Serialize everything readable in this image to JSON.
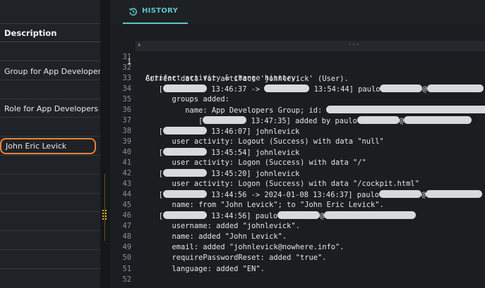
{
  "left": {
    "column_header": "Description",
    "rows": [
      {
        "label": ""
      },
      {
        "label": "Group for App Developers"
      },
      {
        "label": ""
      },
      {
        "label": "Role for App Developers"
      },
      {
        "label": ""
      },
      {
        "label": "John Eric Levick",
        "selected": true
      },
      {
        "label": ""
      },
      {
        "label": ""
      },
      {
        "label": ""
      },
      {
        "label": ""
      },
      {
        "label": ""
      },
      {
        "label": ""
      }
    ]
  },
  "history": {
    "tab_label": "HISTORY",
    "tab_icon": "history-icon",
    "first_line_number": "1",
    "first_line_text": "Current data for artifact 'johnlevick' (User).",
    "fold_marker": "···",
    "lines": [
      {
        "n": "31",
        "parts": []
      },
      {
        "n": "32",
        "parts": []
      },
      {
        "n": "33",
        "parts": [
          {
            "t": "Artifact activity & change history:"
          }
        ]
      },
      {
        "n": "34",
        "parts": [
          {
            "t": "   ["
          },
          {
            "r": 62
          },
          {
            "t": " 13:46:37 -> "
          },
          {
            "r": 64
          },
          {
            "t": " 13:54:44] paulo"
          },
          {
            "r": 60
          },
          {
            "t": "@"
          },
          {
            "r": 80
          }
        ]
      },
      {
        "n": "35",
        "parts": [
          {
            "t": "      groups added:"
          }
        ]
      },
      {
        "n": "36",
        "parts": [
          {
            "t": "         name: App Developers Group; id: "
          },
          {
            "r": 230
          }
        ]
      },
      {
        "n": "37",
        "parts": [
          {
            "t": "            ["
          },
          {
            "r": 62
          },
          {
            "t": " 13:47:35] added by paulo"
          },
          {
            "r": 60
          },
          {
            "t": "@"
          },
          {
            "r": 96
          }
        ]
      },
      {
        "n": "38",
        "parts": [
          {
            "t": "   ["
          },
          {
            "r": 62
          },
          {
            "t": " 13:46:07] johnlevick"
          }
        ]
      },
      {
        "n": "39",
        "parts": [
          {
            "t": "      user activity: Logout (Success) with data \"null\""
          }
        ]
      },
      {
        "n": "40",
        "parts": [
          {
            "t": "   ["
          },
          {
            "r": 62
          },
          {
            "t": " 13:45:54] johnlevick"
          }
        ]
      },
      {
        "n": "41",
        "parts": [
          {
            "t": "      user activity: Logon (Success) with data \"/\""
          }
        ]
      },
      {
        "n": "42",
        "parts": [
          {
            "t": "   ["
          },
          {
            "r": 62
          },
          {
            "t": " 13:45:20] johnlevick"
          }
        ]
      },
      {
        "n": "43",
        "parts": [
          {
            "t": "      user activity: Logon (Success) with data \"/cockpit.html\""
          }
        ]
      },
      {
        "n": "44",
        "parts": [
          {
            "t": "   ["
          },
          {
            "r": 62
          },
          {
            "t": " 13:44:56 -> 2024-01-08 13:46:37] paulo"
          },
          {
            "r": 60
          },
          {
            "t": "@"
          },
          {
            "r": 80
          }
        ]
      },
      {
        "n": "45",
        "parts": [
          {
            "t": "      name: from \"John Levick\"; to \"John Eric Levick\"."
          }
        ]
      },
      {
        "n": "46",
        "parts": [
          {
            "t": "   ["
          },
          {
            "r": 62
          },
          {
            "t": " 13:44:56] paulo"
          },
          {
            "r": 60
          },
          {
            "t": "@"
          },
          {
            "r": 130
          }
        ]
      },
      {
        "n": "47",
        "parts": [
          {
            "t": "      username: added \"johnlevick\"."
          }
        ]
      },
      {
        "n": "48",
        "parts": [
          {
            "t": "      name: added \"John Levick\"."
          }
        ]
      },
      {
        "n": "49",
        "parts": [
          {
            "t": "      email: added \"johnlevick@nowhere.info\"."
          }
        ]
      },
      {
        "n": "50",
        "parts": [
          {
            "t": "      requirePasswordReset: added \"true\"."
          }
        ]
      },
      {
        "n": "51",
        "parts": [
          {
            "t": "      language: added \"EN\"."
          }
        ]
      },
      {
        "n": "52",
        "parts": []
      }
    ]
  },
  "colors": {
    "accent": "#5dc5c9",
    "selection_outline": "#e8833a",
    "splitter_grip": "#f0b429"
  }
}
